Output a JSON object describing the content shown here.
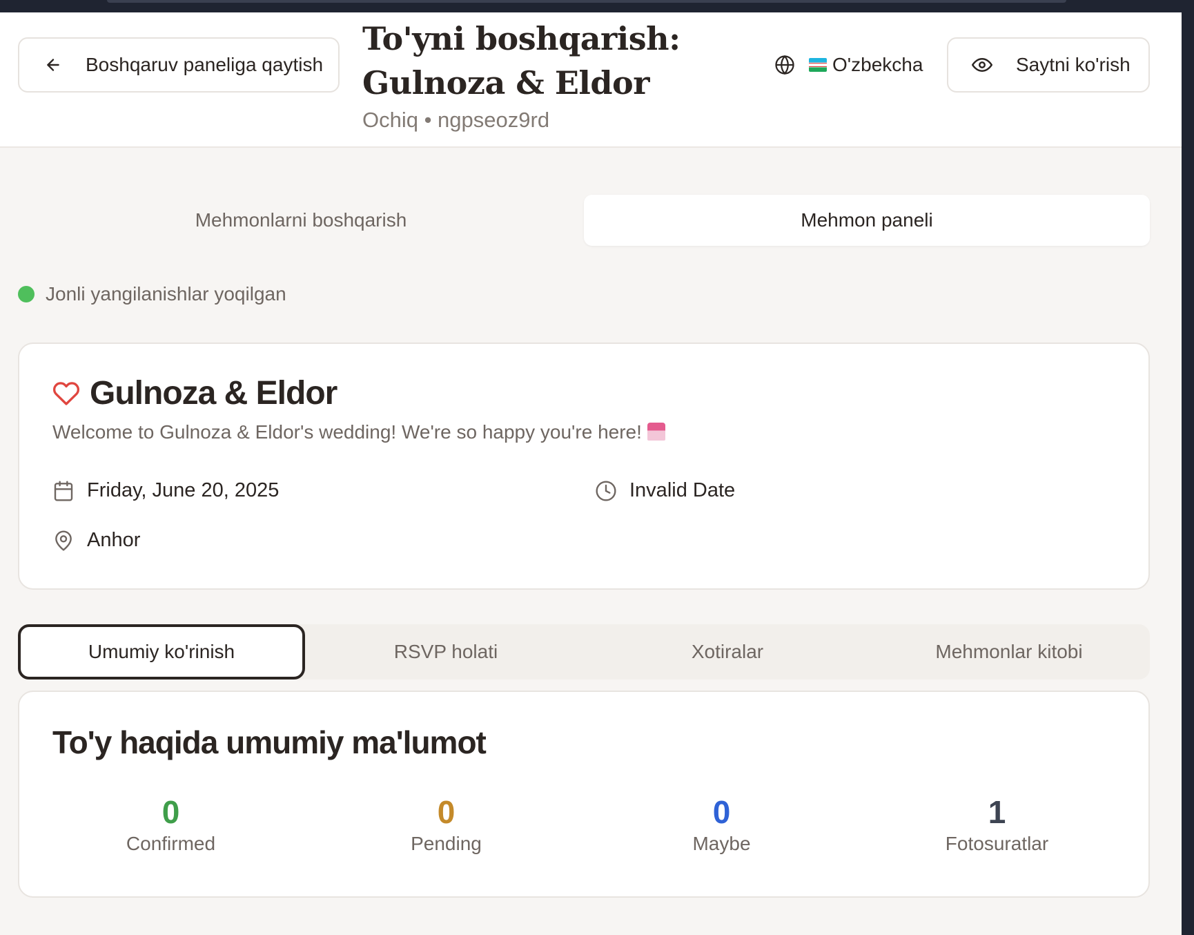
{
  "header": {
    "back_label": "Boshqaruv paneliga qaytish",
    "title": "To'yni boshqarish: Gulnoza & Eldor",
    "title_line1": "To'yni boshqarish:",
    "title_line2": "Gulnoza & Eldor",
    "subtitle": "Ochiq • ngpseoz9rd",
    "language": "O'zbekcha",
    "view_site_label": "Saytni ko'rish"
  },
  "main_tabs": [
    {
      "label": "Mehmonlarni boshqarish",
      "active": false
    },
    {
      "label": "Mehmon paneli",
      "active": true
    }
  ],
  "live_status": "Jonli yangilanishlar yoqilgan",
  "event": {
    "name": "Gulnoza & Eldor",
    "welcome": "Welcome to Gulnoza & Eldor's wedding! We're so happy you're here!",
    "date": "Friday, June 20, 2025",
    "time": "Invalid Date",
    "location": "Anhor"
  },
  "sub_tabs": [
    {
      "label": "Umumiy ko'rinish",
      "active": true
    },
    {
      "label": "RSVP holati",
      "active": false
    },
    {
      "label": "Xotiralar",
      "active": false
    },
    {
      "label": "Mehmonlar kitobi",
      "active": false
    }
  ],
  "overview": {
    "title": "To'y haqida umumiy ma'lumot",
    "stats": [
      {
        "value": "0",
        "label": "Confirmed",
        "color": "#3f9e4a"
      },
      {
        "value": "0",
        "label": "Pending",
        "color": "#c48a2a"
      },
      {
        "value": "0",
        "label": "Maybe",
        "color": "#2f62d6"
      },
      {
        "value": "1",
        "label": "Fotosuratlar",
        "color": "#3d4452"
      }
    ]
  },
  "colors": {
    "live_dot": "#4fbf5c",
    "heart": "#e0463f"
  }
}
